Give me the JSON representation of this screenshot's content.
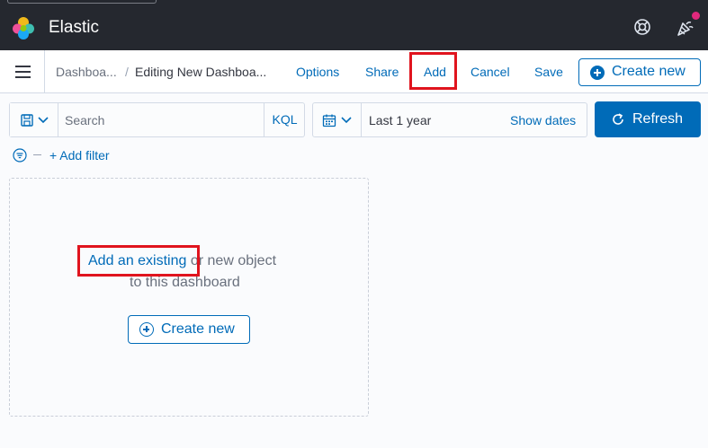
{
  "header": {
    "brand": "Elastic",
    "logo_icon": "elastic-logo-icon",
    "help_icon": "help-lifebuoy-icon",
    "news_icon": "newsfeed-icon",
    "news_badge_color": "#e0287c"
  },
  "nav": {
    "menu_icon": "hamburger-menu-icon",
    "breadcrumbs": [
      "Dashboa...",
      "Editing New Dashboa..."
    ],
    "breadcrumb_separator": "/",
    "actions": {
      "options": "Options",
      "share": "Share",
      "add": "Add",
      "cancel": "Cancel",
      "save": "Save"
    },
    "create_new": "Create new"
  },
  "query": {
    "search_placeholder": "Search",
    "search_value": "",
    "language": "KQL",
    "time_range": "Last 1 year",
    "show_dates": "Show dates",
    "refresh": "Refresh"
  },
  "filters": {
    "add_filter": "+ Add filter"
  },
  "empty_state": {
    "link_text": "Add an existing",
    "line1_rest": " or new object",
    "line2": "to this dashboard",
    "create_new": "Create new"
  },
  "colors": {
    "header_bg": "#25282f",
    "accent": "#006bb8",
    "highlight": "#e0141e"
  }
}
